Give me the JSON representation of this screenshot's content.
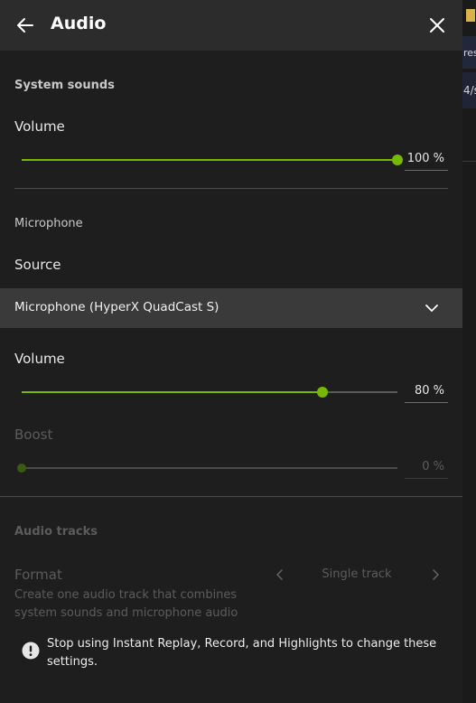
{
  "background_window": {
    "peek_text_1": "res",
    "peek_text_2": "4/s"
  },
  "header": {
    "title": "Audio",
    "back_icon": "arrow-left-icon",
    "close_icon": "close-icon"
  },
  "system_sounds": {
    "section_title": "System sounds",
    "volume_label": "Volume",
    "volume_value": "100 %",
    "volume_level": 1.0
  },
  "microphone": {
    "section_title": "Microphone",
    "source_label": "Source",
    "source_selected": "Microphone (HyperX QuadCast S)",
    "volume_label": "Volume",
    "volume_value": "80 %",
    "volume_level": 0.8,
    "boost_label": "Boost",
    "boost_value": "0 %",
    "boost_level": 0.0
  },
  "audio_tracks": {
    "section_title": "Audio tracks",
    "format_label": "Format",
    "format_value": "Single track",
    "description": "Create one audio track that combines system sounds and microphone audio"
  },
  "notice": {
    "text": "Stop using Instant Replay, Record, and Highlights to change these settings.",
    "icon": "exclamation-circle-icon"
  },
  "colors": {
    "accent": "#76b900",
    "header_bg": "#2c2c2c",
    "panel_bg": "#1e1e1e",
    "dropdown_bg": "#3a3a3a"
  }
}
